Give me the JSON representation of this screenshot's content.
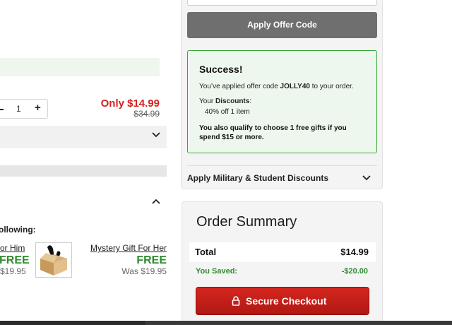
{
  "cart": {
    "quantity": "1",
    "price_now": "Only $14.99",
    "price_was": "$34.99"
  },
  "gifts": {
    "heading": "ollowing:",
    "him": {
      "name": "or Him",
      "free": "FREE",
      "was": "$19.95"
    },
    "her": {
      "name": "Mystery Gift For Her",
      "free": "FREE",
      "was": "Was $19.95"
    }
  },
  "offer": {
    "apply_label": "Apply Offer Code",
    "success_title": "Success!",
    "msg_before": "You’ve applied offer code ",
    "code": "JOLLY40",
    "msg_after": " to your order.",
    "discounts_prefix": "Your ",
    "discounts_label": "Discounts",
    "discounts_suffix": ":",
    "discount_item": "40% off 1 item",
    "qualify": "You also qualify to choose 1 free gifts if you spend $15 or more."
  },
  "military": {
    "label": "Apply Military & Student Discounts"
  },
  "summary": {
    "title": "Order Summary",
    "total_label": "Total",
    "total_value": "$14.99",
    "saved_label": "You Saved:",
    "saved_value": "-$20.00",
    "checkout_label": "Secure Checkout"
  },
  "colors": {
    "success_green": "#2e8b2e",
    "price_red": "#d42222",
    "checkout_red": "#c41f18",
    "apply_gray": "#6f6f6f"
  },
  "icons": [
    "minus-icon",
    "plus-icon",
    "chevron-down-icon",
    "chevron-up-icon",
    "gift-box-icon",
    "lock-icon"
  ]
}
